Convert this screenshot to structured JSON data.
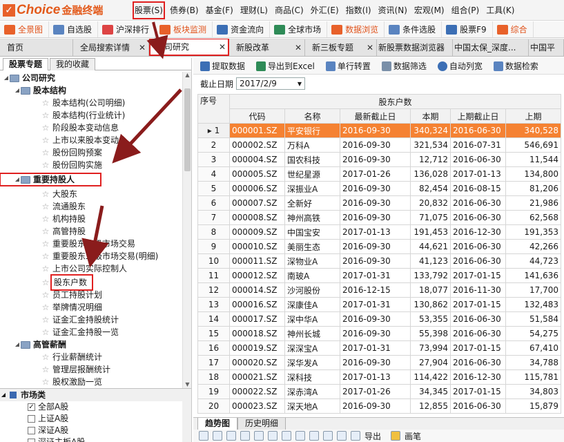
{
  "brand": {
    "logo": "Choice",
    "sub": "金融终端"
  },
  "menu": [
    "股票(S)",
    "债券(B)",
    "基金(F)",
    "理财(L)",
    "商品(C)",
    "外汇(E)",
    "指数(I)",
    "资讯(N)",
    "宏观(M)",
    "组合(P)",
    "工具(K)"
  ],
  "toolbar": [
    "全景图",
    "自选股",
    "沪深排行",
    "板块监测",
    "资金流向",
    "全球市场",
    "数据浏览",
    "条件选股",
    "股票F9",
    "综合"
  ],
  "tabs": [
    "首页",
    "全局搜索详情",
    "公司研究",
    "新股改革",
    "新三板专题",
    "新股票数据浏览器",
    "中国太保_深度...",
    "中国平"
  ],
  "left_tabs": [
    "股票专题",
    "我的收藏"
  ],
  "tree": {
    "root": "公司研究",
    "g1": "股本结构",
    "g1_items": [
      "股本结构(公司明细)",
      "股本结构(行业统计)",
      "阶段股本变动信息",
      "上市以来股本变动",
      "股份回购预案",
      "股份回购实施"
    ],
    "g2": "重要持股人",
    "g2_items": [
      "大股东",
      "流通股东",
      "机构持股",
      "高管持股",
      "重要股东二级市场交易",
      "重要股东二级市场交易(明细)",
      "上市公司实际控制人",
      "股东户数",
      "员工持股计划",
      "举牌情况明细",
      "证金汇金持股统计",
      "证金汇金持股一览"
    ],
    "g3": "高管薪酬",
    "g3_items": [
      "行业薪酬统计",
      "管理层报酬统计",
      "股权激励一览"
    ]
  },
  "market": {
    "title": "市场类",
    "items": [
      {
        "label": "全部A股",
        "checked": "✓"
      },
      {
        "label": "上证A股",
        "checked": ""
      },
      {
        "label": "深证A股",
        "checked": ""
      },
      {
        "label": "深证主板A股",
        "checked": ""
      }
    ]
  },
  "right_toolbar": [
    "提取数据",
    "导出到Excel",
    "单行转置",
    "数据筛选",
    "自动列宽",
    "数据检索"
  ],
  "date": {
    "label": "截止日期",
    "value": "2017/2/9"
  },
  "grid": {
    "h_index": "序号",
    "h_group": "股东户数",
    "headers": [
      "代码",
      "名称",
      "最新截止日",
      "本期",
      "上期截止日",
      "上期"
    ],
    "rows": [
      [
        "1",
        "000001.SZ",
        "平安银行",
        "2016-09-30",
        "340,324",
        "2016-06-30",
        "340,528"
      ],
      [
        "2",
        "000002.SZ",
        "万科A",
        "2016-09-30",
        "321,534",
        "2016-07-31",
        "546,691"
      ],
      [
        "3",
        "000004.SZ",
        "国农科技",
        "2016-09-30",
        "12,712",
        "2016-06-30",
        "11,544"
      ],
      [
        "4",
        "000005.SZ",
        "世纪星源",
        "2017-01-26",
        "136,028",
        "2017-01-13",
        "134,800"
      ],
      [
        "5",
        "000006.SZ",
        "深振业A",
        "2016-09-30",
        "82,454",
        "2016-08-15",
        "81,206"
      ],
      [
        "6",
        "000007.SZ",
        "全新好",
        "2016-09-30",
        "20,832",
        "2016-06-30",
        "21,986"
      ],
      [
        "7",
        "000008.SZ",
        "神州高铁",
        "2016-09-30",
        "71,075",
        "2016-06-30",
        "62,568"
      ],
      [
        "8",
        "000009.SZ",
        "中国宝安",
        "2017-01-13",
        "191,453",
        "2016-12-30",
        "191,353"
      ],
      [
        "9",
        "000010.SZ",
        "美丽生态",
        "2016-09-30",
        "44,621",
        "2016-06-30",
        "42,266"
      ],
      [
        "10",
        "000011.SZ",
        "深物业A",
        "2016-09-30",
        "41,123",
        "2016-06-30",
        "44,723"
      ],
      [
        "11",
        "000012.SZ",
        "南玻A",
        "2017-01-31",
        "133,792",
        "2017-01-15",
        "141,636"
      ],
      [
        "12",
        "000014.SZ",
        "沙河股份",
        "2016-12-15",
        "18,077",
        "2016-11-30",
        "17,700"
      ],
      [
        "13",
        "000016.SZ",
        "深康佳A",
        "2017-01-31",
        "130,862",
        "2017-01-15",
        "132,483"
      ],
      [
        "14",
        "000017.SZ",
        "深中华A",
        "2016-09-30",
        "53,355",
        "2016-06-30",
        "51,584"
      ],
      [
        "15",
        "000018.SZ",
        "神州长城",
        "2016-09-30",
        "55,398",
        "2016-06-30",
        "54,275"
      ],
      [
        "16",
        "000019.SZ",
        "深深宝A",
        "2017-01-31",
        "73,994",
        "2017-01-15",
        "67,410"
      ],
      [
        "17",
        "000020.SZ",
        "深华发A",
        "2016-09-30",
        "27,904",
        "2016-06-30",
        "34,788"
      ],
      [
        "18",
        "000021.SZ",
        "深科技",
        "2017-01-13",
        "114,422",
        "2016-12-30",
        "115,781"
      ],
      [
        "19",
        "000022.SZ",
        "深赤湾A",
        "2017-01-26",
        "34,345",
        "2017-01-15",
        "34,803"
      ],
      [
        "20",
        "000023.SZ",
        "深天地A",
        "2016-09-30",
        "12,855",
        "2016-06-30",
        "15,879"
      ]
    ]
  },
  "bottom_tabs": [
    "趋势图",
    "历史明细"
  ],
  "bottom_bar": {
    "export": "导出",
    "pen": "画笔"
  }
}
